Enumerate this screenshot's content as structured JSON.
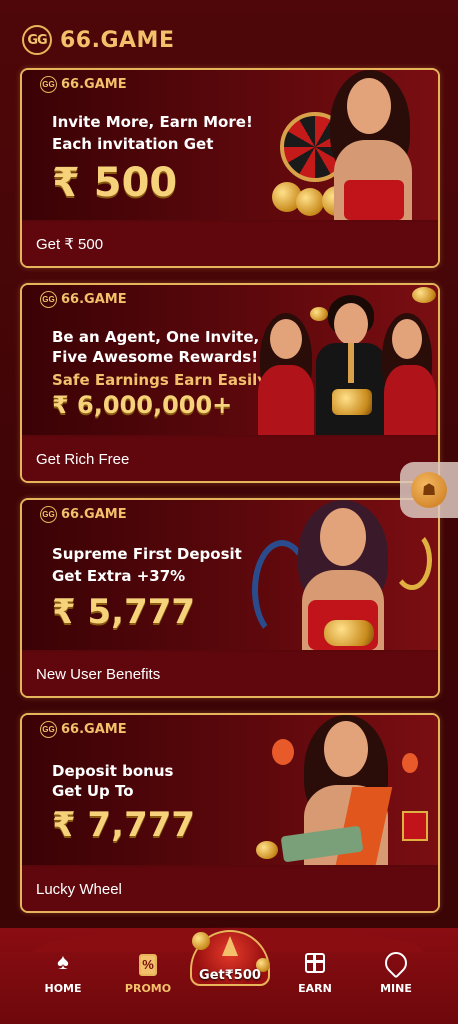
{
  "header": {
    "logo_mark": "GG",
    "brand": "66.GAME"
  },
  "cards": [
    {
      "mini_logo": "66.GAME",
      "headline_1": "Invite More, Earn More!",
      "headline_2": "Each invitation Get",
      "amount": "₹ 500",
      "caption": "Get ₹ 500"
    },
    {
      "mini_logo": "66.GAME",
      "headline_1": "Be an Agent, One Invite,",
      "headline_2": "Five Awesome Rewards!",
      "subline": "Safe Earnings Earn Easily",
      "amount": "₹ 6,000,000+",
      "caption": "Get Rich Free"
    },
    {
      "mini_logo": "66.GAME",
      "headline_1": "Supreme First Deposit",
      "headline_2": "Get Extra +37%",
      "amount": "₹ 5,777",
      "caption": "New User Benefits"
    },
    {
      "mini_logo": "66.GAME",
      "headline_1": "Deposit bonus",
      "headline_2": "Get Up To",
      "amount": "₹ 7,777",
      "caption": "Lucky Wheel"
    }
  ],
  "nav": {
    "home": "HOME",
    "promo": "PROMO",
    "center": "Get₹500",
    "earn": "EARN",
    "mine": "MINE",
    "active": "promo"
  },
  "colors": {
    "accent": "#f3c16b",
    "background": "#4a0608",
    "border": "#e6b45a"
  }
}
